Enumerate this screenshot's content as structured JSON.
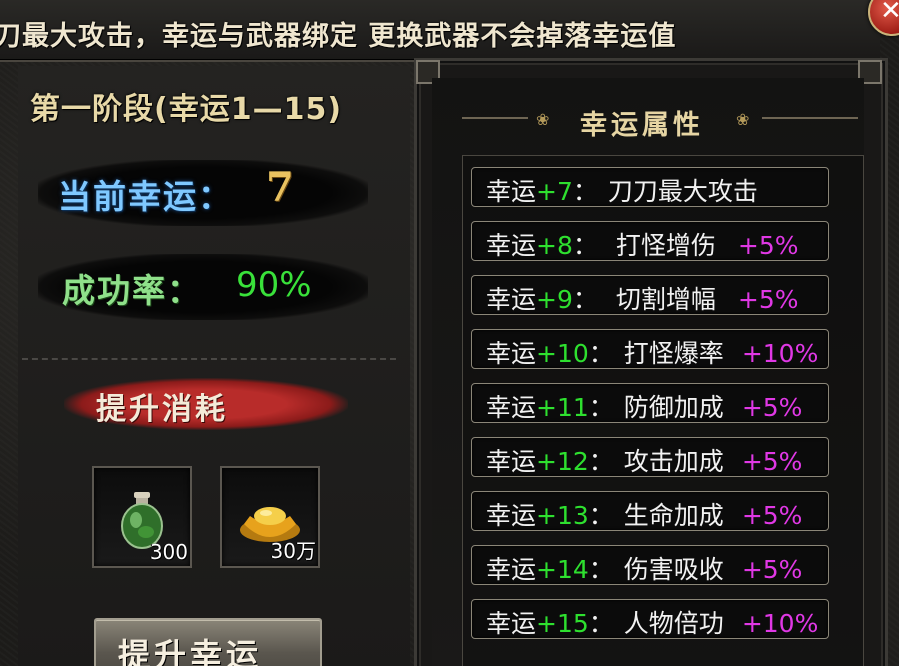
{
  "banner": {
    "text": "刀最大攻击，幸运与武器绑定 更换武器不会掉落幸运值"
  },
  "close": {
    "icon": "close-icon",
    "glyph": "✕"
  },
  "left": {
    "stage_title": "第一阶段(幸运1—15)",
    "current_luck_label": "当前幸运：",
    "current_luck_value": "7",
    "success_rate_label": "成功率：",
    "success_rate_value": "90%",
    "cost_label": "提升消耗",
    "items": [
      {
        "name": "green-potion",
        "icon": "potion-icon",
        "qty": "300"
      },
      {
        "name": "gold-ingot",
        "icon": "gold-ingot-icon",
        "qty": "30万"
      }
    ],
    "upgrade_button": "提升幸运"
  },
  "right": {
    "title": "幸运属性",
    "rows": [
      {
        "prefix": "幸运",
        "plus": "+7",
        "sep": "：",
        "attr": "刀刀最大攻击",
        "bonus": ""
      },
      {
        "prefix": "幸运",
        "plus": "+8",
        "sep": "：",
        "attr": "打怪增伤",
        "bonus": "+5%"
      },
      {
        "prefix": "幸运",
        "plus": "+9",
        "sep": "：",
        "attr": "切割增幅",
        "bonus": "+5%"
      },
      {
        "prefix": "幸运",
        "plus": "+10",
        "sep": "：",
        "attr": "打怪爆率",
        "bonus": "+10%"
      },
      {
        "prefix": "幸运",
        "plus": "+11",
        "sep": "：",
        "attr": "防御加成",
        "bonus": "+5%"
      },
      {
        "prefix": "幸运",
        "plus": "+12",
        "sep": "：",
        "attr": "攻击加成",
        "bonus": "+5%"
      },
      {
        "prefix": "幸运",
        "plus": "+13",
        "sep": "：",
        "attr": "生命加成",
        "bonus": "+5%"
      },
      {
        "prefix": "幸运",
        "plus": "+14",
        "sep": "：",
        "attr": "伤害吸收",
        "bonus": "+5%"
      },
      {
        "prefix": "幸运",
        "plus": "+15",
        "sep": "：",
        "attr": "人物倍功",
        "bonus": "+10%"
      }
    ]
  },
  "colors": {
    "green": "#2ee02f",
    "magenta": "#e038e5",
    "gold": "#e9c260",
    "blue": "#7fc8ff"
  }
}
